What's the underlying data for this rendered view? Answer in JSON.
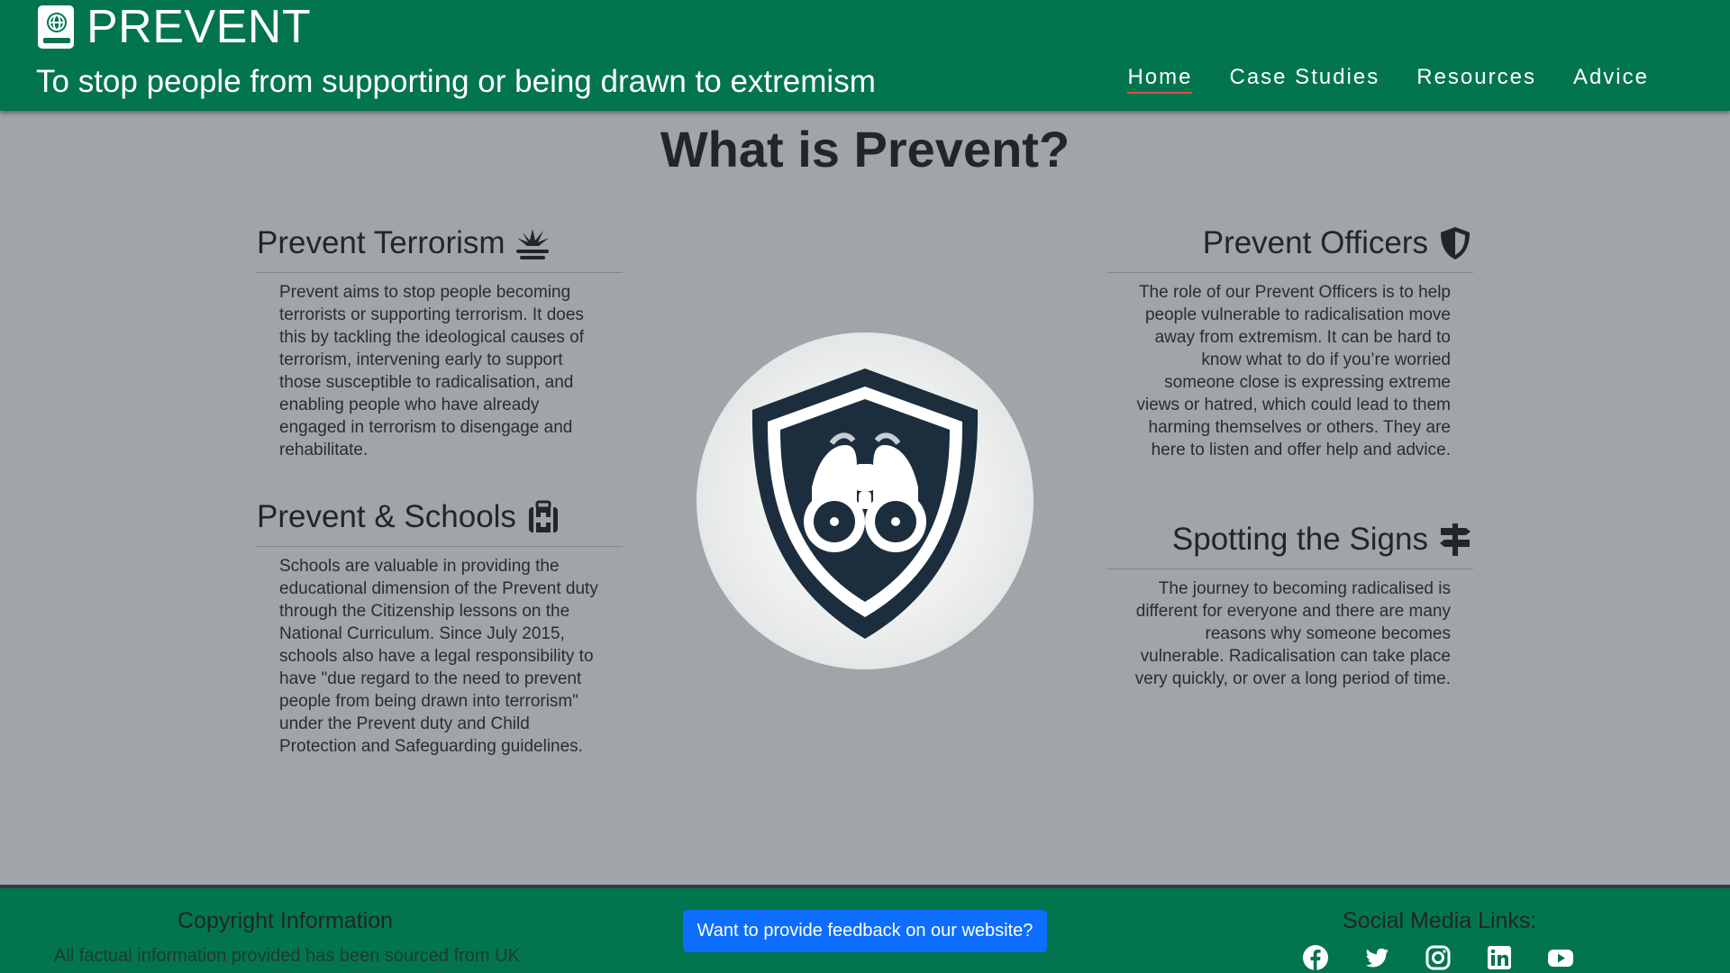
{
  "header": {
    "brand": "PREVENT",
    "tagline": "To stop people from supporting or being drawn to extremism",
    "nav": [
      "Home",
      "Case Studies",
      "Resources",
      "Advice"
    ],
    "active_nav": "Home",
    "brand_icon": "globe-book-icon",
    "color": "#03754e"
  },
  "main": {
    "title": "What is Prevent?",
    "sections": {
      "terrorism": {
        "title": "Prevent Terrorism",
        "icon": "explosion-icon",
        "text": "Prevent aims to stop people becoming terrorists or supporting terrorism. It does this by tackling the ideological causes of terrorism, intervening early to support those susceptible to radicalisation, and enabling people who have already engaged in terrorism to disengage and rehabilitate."
      },
      "schools": {
        "title": "Prevent & Schools",
        "icon": "first-aid-bag-icon",
        "text": "Schools are valuable in providing the educational dimension of the Prevent duty through the Citizenship lessons on the National Curriculum. Since July 2015, schools also have a legal responsibility to have \"due regard to the need to prevent people from being drawn into terrorism\" under the Prevent duty and Child Protection and Safeguarding guidelines."
      },
      "officers": {
        "title": "Prevent Officers",
        "icon": "shield-icon",
        "text": "The role of our Prevent Officers is to help people vulnerable to radicalisation move away from extremism. It can be hard to know what to do if you’re worried someone close is expressing extreme views or hatred, which could lead to them harming themselves or others. They are here to listen and offer help and advice."
      },
      "signs": {
        "title": "Spotting the Signs",
        "icon": "signpost-icon",
        "text": "The journey to becoming radicalised is different for everyone and there are many reasons why someone becomes vulnerable. Radicalisation can take place very quickly, or over a long period of time."
      }
    },
    "center_image": "shield-binoculars-logo"
  },
  "footer": {
    "copyright_title": "Copyright Information",
    "copyright_text": "All factual information provided has been sourced from UK",
    "feedback_button": "Want to provide feedback on our website?",
    "social_title": "Social Media Links:",
    "social_icons": [
      "facebook-icon",
      "twitter-icon",
      "instagram-icon",
      "linkedin-icon",
      "youtube-icon"
    ]
  }
}
